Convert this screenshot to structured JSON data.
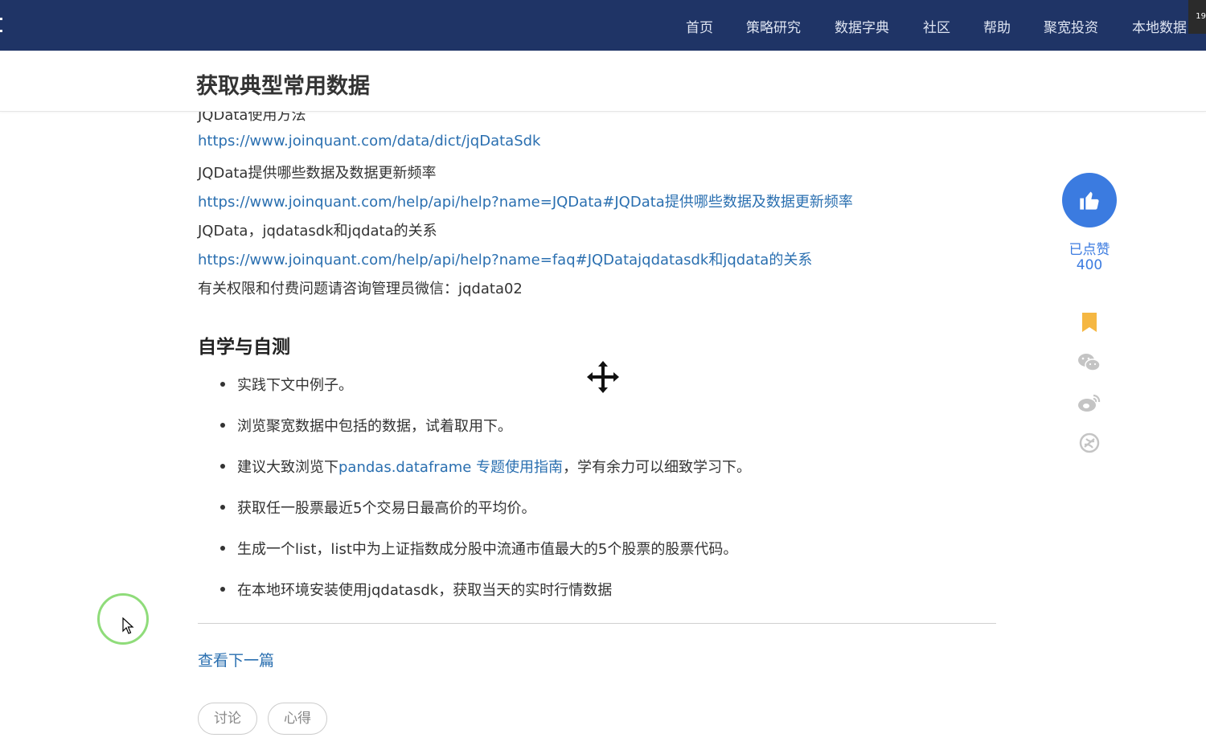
{
  "nav": {
    "items": [
      "首页",
      "策略研究",
      "数据字典",
      "社区",
      "帮助",
      "聚宽投资",
      "本地数据"
    ],
    "badge": "19"
  },
  "page": {
    "title": "获取典型常用数据"
  },
  "content": {
    "partial_line": "JQData使用方法",
    "lines": [
      {
        "text": "https://www.joinquant.com/data/dict/jqDataSdk",
        "link": true
      },
      {
        "text": "JQData提供哪些数据及数据更新频率",
        "link": false
      },
      {
        "text": "https://www.joinquant.com/help/api/help?name=JQData#JQData提供哪些数据及数据更新频率",
        "link": true
      },
      {
        "text": "JQData，jqdatasdk和jqdata的关系",
        "link": false
      },
      {
        "text": "https://www.joinquant.com/help/api/help?name=faq#JQDatajqdatasdk和jqdata的关系",
        "link": true
      },
      {
        "text": "有关权限和付费问题请咨询管理员微信：jqdata02",
        "link": false
      }
    ],
    "section_heading": "自学与自测",
    "tasks": [
      {
        "text": "实践下文中例子。"
      },
      {
        "text": "浏览聚宽数据中包括的数据，试着取用下。"
      },
      {
        "pre": "建议大致浏览下",
        "link": "pandas.dataframe 专题使用指南",
        "post": "，学有余力可以细致学习下。"
      },
      {
        "text": "获取任一股票最近5个交易日最高价的平均价。"
      },
      {
        "text": "生成一个list，list中为上证指数成分股中流通市值最大的5个股票的股票代码。"
      },
      {
        "text": "在本地环境安装使用jqdatasdk，获取当天的实时行情数据"
      }
    ],
    "next_article": "查看下一篇",
    "tags": [
      "讨论",
      "心得"
    ]
  },
  "sidebar": {
    "like_label": "已点赞",
    "like_count": "400",
    "icons": [
      "bookmark-icon",
      "wechat-icon",
      "weibo-icon",
      "share-icon"
    ]
  },
  "colors": {
    "nav_bg": "#1f3466",
    "link": "#2a6fb0",
    "like_blue": "#3b7be0",
    "bookmark": "#f5b742"
  }
}
